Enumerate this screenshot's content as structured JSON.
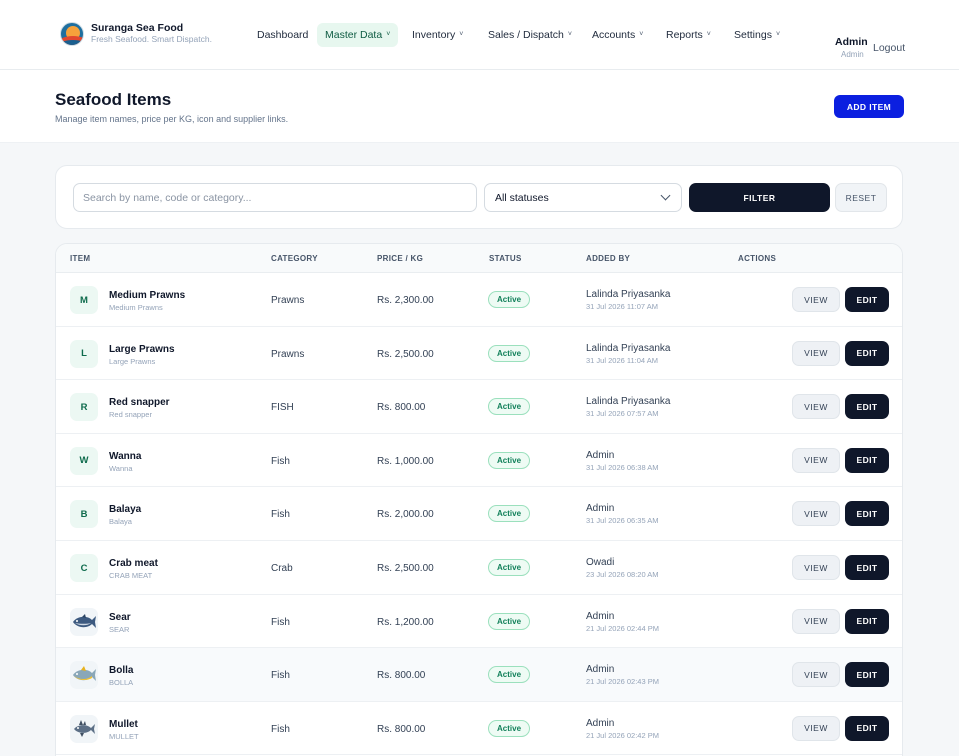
{
  "brand": {
    "name": "Suranga Sea Food",
    "tagline": "Fresh Seafood. Smart Dispatch."
  },
  "nav": [
    {
      "label": "Dashboard",
      "has_menu": false,
      "active": false
    },
    {
      "label": "Master Data",
      "has_menu": true,
      "active": true
    },
    {
      "label": "Inventory",
      "has_menu": true,
      "active": false
    },
    {
      "label": "Sales / Dispatch",
      "has_menu": true,
      "active": false
    },
    {
      "label": "Accounts",
      "has_menu": true,
      "active": false
    },
    {
      "label": "Reports",
      "has_menu": true,
      "active": false
    },
    {
      "label": "Settings",
      "has_menu": true,
      "active": false
    }
  ],
  "user": {
    "name": "Admin",
    "role": "Admin",
    "logout_label": "Logout"
  },
  "page": {
    "title": "Seafood Items",
    "subtitle": "Manage item names, price per KG, icon and supplier links.",
    "add_label": "ADD ITEM"
  },
  "filters": {
    "search_placeholder": "Search by name, code or category...",
    "search_value": "",
    "status_value": "All statuses",
    "filter_label": "FILTER",
    "reset_label": "RESET"
  },
  "table": {
    "headers": {
      "item": "ITEM",
      "category": "CATEGORY",
      "price": "PRICE / KG",
      "status": "STATUS",
      "added_by": "ADDED BY",
      "actions": "ACTIONS"
    },
    "view_label": "VIEW",
    "edit_label": "EDIT",
    "rows": [
      {
        "initial": "M",
        "icon": null,
        "name": "Medium Prawns",
        "code": "Medium Prawns",
        "category": "Prawns",
        "price": "Rs. 2,300.00",
        "status": "Active",
        "added_by": "Lalinda Priyasanka",
        "added_at": "31 Jul 2026 11:07 AM"
      },
      {
        "initial": "L",
        "icon": null,
        "name": "Large Prawns",
        "code": "Large Prawns",
        "category": "Prawns",
        "price": "Rs. 2,500.00",
        "status": "Active",
        "added_by": "Lalinda Priyasanka",
        "added_at": "31 Jul 2026 11:04 AM"
      },
      {
        "initial": "R",
        "icon": null,
        "name": "Red snapper",
        "code": "Red snapper",
        "category": "FISH",
        "price": "Rs. 800.00",
        "status": "Active",
        "added_by": "Lalinda Priyasanka",
        "added_at": "31 Jul 2026 07:57 AM"
      },
      {
        "initial": "W",
        "icon": null,
        "name": "Wanna",
        "code": "Wanna",
        "category": "Fish",
        "price": "Rs. 1,000.00",
        "status": "Active",
        "added_by": "Admin",
        "added_at": "31 Jul 2026 06:38 AM"
      },
      {
        "initial": "B",
        "icon": null,
        "name": "Balaya",
        "code": "Balaya",
        "category": "Fish",
        "price": "Rs. 2,000.00",
        "status": "Active",
        "added_by": "Admin",
        "added_at": "31 Jul 2026 06:35 AM"
      },
      {
        "initial": "C",
        "icon": null,
        "name": "Crab meat",
        "code": "CRAB MEAT",
        "category": "Crab",
        "price": "Rs. 2,500.00",
        "status": "Active",
        "added_by": "Owadi",
        "added_at": "23 Jul 2026 08:20 AM"
      },
      {
        "initial": "",
        "icon": "tuna-fish-icon",
        "name": "Sear",
        "code": "SEAR",
        "category": "Fish",
        "price": "Rs. 1,200.00",
        "status": "Active",
        "added_by": "Admin",
        "added_at": "21 Jul 2026 02:44 PM"
      },
      {
        "initial": "",
        "icon": "yellow-fish-icon",
        "name": "Bolla",
        "code": "BOLLA",
        "category": "Fish",
        "price": "Rs. 800.00",
        "status": "Active",
        "added_by": "Admin",
        "added_at": "21 Jul 2026 02:43 PM"
      },
      {
        "initial": "",
        "icon": "spiky-fish-icon",
        "name": "Mullet",
        "code": "MULLET",
        "category": "Fish",
        "price": "Rs. 800.00",
        "status": "Active",
        "added_by": "Admin",
        "added_at": "21 Jul 2026 02:42 PM"
      }
    ]
  },
  "colors": {
    "primary_dark": "#0f172a",
    "accent_blue": "#0b1fe0",
    "active_green": "#12805a",
    "nav_active_bg": "#e7f7ef"
  }
}
